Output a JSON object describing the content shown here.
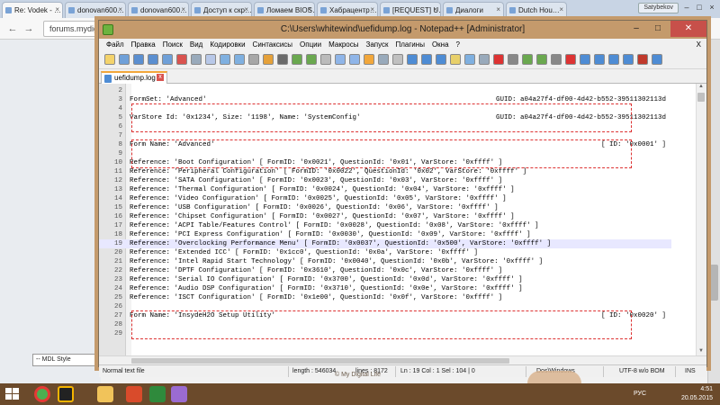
{
  "browser": {
    "tabs": [
      "Re: Vodek - …",
      "donovan600…",
      "donovan600…",
      "Доступ к скр…",
      "Ломаем BIOS…",
      "Хабрацентр…",
      "[REQUEST] U…",
      "Диалоги",
      "Dutch Hou…"
    ],
    "tab_close": "×",
    "user": "Satybekov",
    "win_controls": [
      "–",
      "□",
      "×"
    ],
    "back": "←",
    "forward": "→",
    "address": "forums.mydigitallife.info/threads/...&pageid=638401",
    "mdl_style": "-- MDL Style"
  },
  "npp": {
    "title": "C:\\Users\\whitewind\\uefidump.log - Notepad++ [Administrator]",
    "title_controls": [
      "–",
      "□",
      "✕"
    ],
    "menu": [
      "Файл",
      "Правка",
      "Поиск",
      "Вид",
      "Кодировки",
      "Синтаксисы",
      "Опции",
      "Макросы",
      "Запуск",
      "Плагины",
      "Окна",
      "?"
    ],
    "menu_close": "X",
    "tab": "uefidump.log",
    "tab_close": "x",
    "lines": [
      {
        "n": "2",
        "t": ""
      },
      {
        "n": "3",
        "t": "FormSet: 'Advanced'",
        "r": "GUID: a04a27f4-df00-4d42-b552-39511302113d"
      },
      {
        "n": "4",
        "t": ""
      },
      {
        "n": "5",
        "t": "VarStore Id: '0x1234', Size: '1198', Name: 'SystemConfig'",
        "r": "GUID: a04a27f4-df00-4d42-b552-39511302113d"
      },
      {
        "n": "6",
        "t": ""
      },
      {
        "n": "7",
        "t": ""
      },
      {
        "n": "8",
        "t": "Form Name: 'Advanced'",
        "r": "[ ID: '0x0001' ]"
      },
      {
        "n": "9",
        "t": ""
      },
      {
        "n": "10",
        "t": "Reference: 'Boot Configuration' [ FormID: '0x0021', QuestionId: '0x01', VarStore: '0xffff' ]"
      },
      {
        "n": "11",
        "t": "Reference: 'Peripheral Configuration' [ FormID: '0x0022', QuestionId: '0x02', VarStore: '0xffff' ]"
      },
      {
        "n": "12",
        "t": "Reference: 'SATA Configuration' [ FormID: '0x0023', QuestionId: '0x03', VarStore: '0xffff' ]"
      },
      {
        "n": "13",
        "t": "Reference: 'Thermal Configuration' [ FormID: '0x0024', QuestionId: '0x04', VarStore: '0xffff' ]"
      },
      {
        "n": "14",
        "t": "Reference: 'Video Configuration' [ FormID: '0x0025', QuestionId: '0x05', VarStore: '0xffff' ]"
      },
      {
        "n": "15",
        "t": "Reference: 'USB Configuration' [ FormID: '0x0026', QuestionId: '0x06', VarStore: '0xffff' ]"
      },
      {
        "n": "16",
        "t": "Reference: 'Chipset Configuration' [ FormID: '0x0027', QuestionId: '0x07', VarStore: '0xffff' ]"
      },
      {
        "n": "17",
        "t": "Reference: 'ACPI Table/Features Control' [ FormID: '0x0028', QuestionId: '0x08', VarStore: '0xffff' ]"
      },
      {
        "n": "18",
        "t": "Reference: 'PCI Express Configuration' [ FormID: '0x0030', QuestionId: '0x09', VarStore: '0xffff' ]"
      },
      {
        "n": "19",
        "t": "Reference: 'Overclocking Performance Menu' [ FormID: '0x0037', QuestionId: '0x500', VarStore: '0xffff' ]",
        "cur": true
      },
      {
        "n": "20",
        "t": "Reference: 'Extended ICC' [ FormID: '0x1cc0', QuestionId: '0x0a', VarStore: '0xffff' ]"
      },
      {
        "n": "21",
        "t": "Reference: 'Intel Rapid Start Technology' [ FormID: '0x0040', QuestionId: '0x0b', VarStore: '0xffff' ]"
      },
      {
        "n": "22",
        "t": "Reference: 'DPTF Configuration' [ FormID: '0x3610', QuestionId: '0x0c', VarStore: '0xffff' ]"
      },
      {
        "n": "23",
        "t": "Reference: 'Serial IO Configuration' [ FormID: '0x3700', QuestionId: '0x0d', VarStore: '0xffff' ]"
      },
      {
        "n": "24",
        "t": "Reference: 'Audio DSP Configuration' [ FormID: '0x3710', QuestionId: '0x0e', VarStore: '0xffff' ]"
      },
      {
        "n": "25",
        "t": "Reference: 'ISCT Configuration' [ FormID: '0x1e00', QuestionId: '0x0f', VarStore: '0xffff' ]"
      },
      {
        "n": "26",
        "t": ""
      },
      {
        "n": "27",
        "t": "Form Name: 'InsydeH2O Setup Utility'",
        "r": "[ ID: '0x0020' ]"
      },
      {
        "n": "28",
        "t": ""
      },
      {
        "n": "29",
        "t": ""
      }
    ],
    "status": {
      "type": "Normal text file",
      "length": "length : 546034",
      "lines": "lines : 8172",
      "pos": "Ln : 19   Col : 1   Sel : 104 | 0",
      "eol": "Dos\\Windows",
      "enc": "UTF-8 w/o BOM",
      "ins": "INS"
    }
  },
  "taskbar": {
    "lang": "РУС",
    "time": "4:51",
    "date": "20.05.2015",
    "watermark": "© My Digital Life"
  },
  "colors": {
    "accent": "#c49a6c",
    "highlight": "#e8e8ff",
    "annotation": "#dd3333"
  }
}
